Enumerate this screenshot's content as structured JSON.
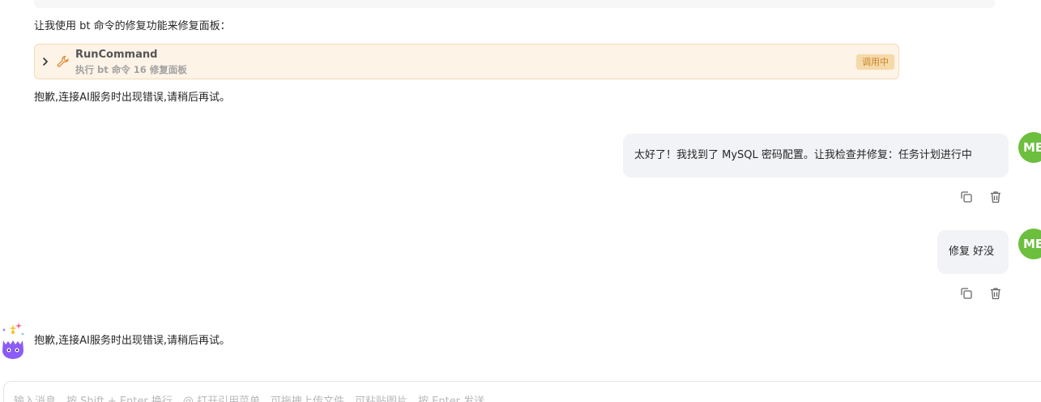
{
  "chat": {
    "ai_intro": "让我使用 bt 命令的修复功能来修复面板：",
    "tool_call": {
      "name": "RunCommand",
      "description": "执行 bt 命令 16 修复面板",
      "status": "调用中",
      "icon": "wrench-icon"
    },
    "ai_error_1": "抱歉,连接AI服务时出现错误,请稍后再试。",
    "user_message_1": "太好了！我找到了 MySQL 密码配置。让我检查并修复：任务计划进行中",
    "user_message_2": "修复 好没",
    "user_avatar_initials": "ME",
    "ai_error_2": "抱歉,连接AI服务时出现错误,请稍后再试。"
  },
  "composer": {
    "placeholder": "输入消息，按 Shift + Enter 换行，@ 打开引用菜单，可拖拽上传文件，可粘贴图片，按 Enter 发送",
    "value": ""
  },
  "colors": {
    "user_avatar": "#6cbf3e",
    "tool_card_bg": "#fdf3e6",
    "tool_status_bg": "#f6d9a9",
    "tool_status_text": "#c8852c",
    "user_bubble_bg": "#f2f3f6"
  }
}
